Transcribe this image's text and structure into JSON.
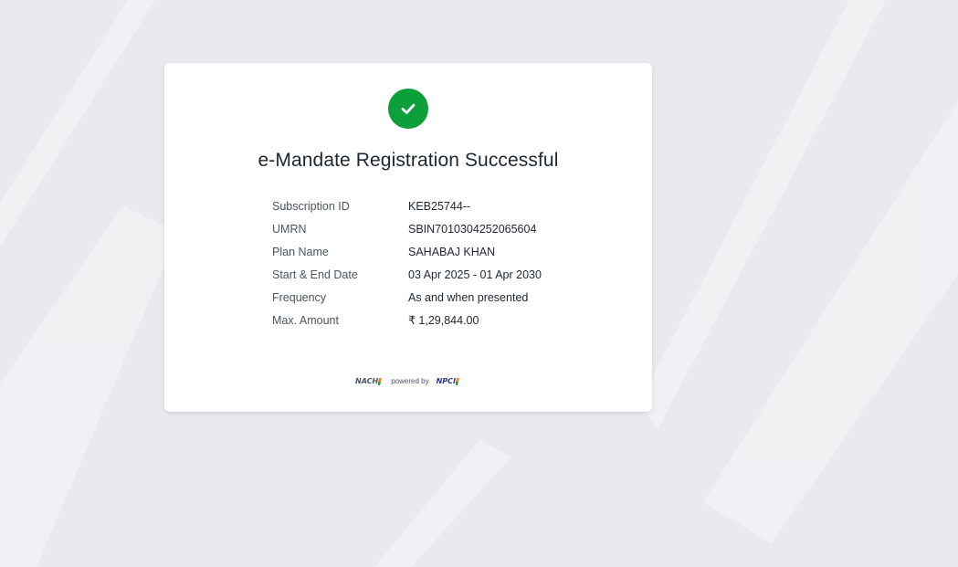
{
  "status": {
    "icon": "check-icon",
    "color": "#0d9f39",
    "title": "e-Mandate Registration Successful"
  },
  "details": [
    {
      "label": "Subscription ID",
      "value": "KEB25744--"
    },
    {
      "label": "UMRN",
      "value": "SBIN7010304252065604"
    },
    {
      "label": "Plan Name",
      "value": "SAHABAJ KHAN"
    },
    {
      "label": "Start & End Date",
      "value": "03 Apr 2025 - 01 Apr 2030"
    },
    {
      "label": "Frequency",
      "value": "As and when presented"
    },
    {
      "label": "Max. Amount",
      "value": "₹ 1,29,844.00"
    }
  ],
  "footer": {
    "nach_logo": "NACH",
    "powered_by": "powered by",
    "npci_logo": "NPCI"
  }
}
